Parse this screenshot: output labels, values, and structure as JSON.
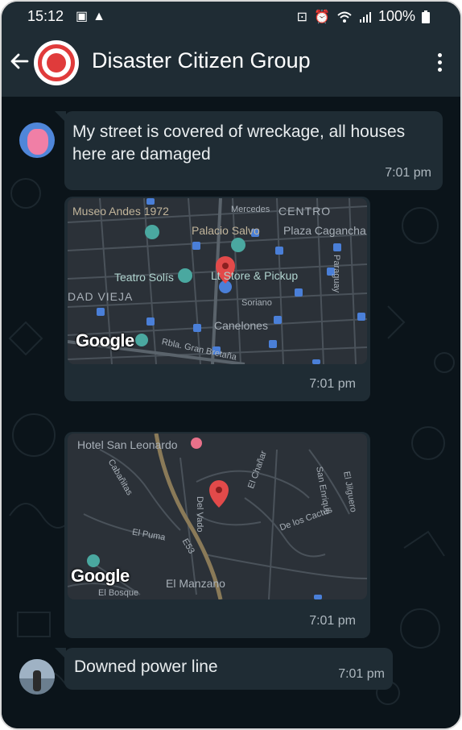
{
  "status_bar": {
    "time": "15:12",
    "left_icons": [
      "image-icon",
      "alert-icon"
    ],
    "right_icons": [
      "lock-icon",
      "alarm-icon",
      "wifi-icon",
      "signal-icon"
    ],
    "battery": "100%"
  },
  "header": {
    "title": "Disaster Citizen Group",
    "back_icon": "back-arrow-icon",
    "menu_icon": "more-vert-icon"
  },
  "messages": [
    {
      "type": "text",
      "text": "My street is covered of wreckage, all houses here are damaged",
      "time": "7:01 pm"
    },
    {
      "type": "location",
      "labels": {
        "museo": "Museo Andes 1972",
        "mercedes": "Mercedes",
        "centro": "CENTRO",
        "palacio": "Palacio Salvo",
        "plaza": "Plaza Cagancha",
        "teatro": "Teatro Solís",
        "store": "Lt Store & Pickup",
        "paraguay": "Paraguay",
        "vieja": "DAD VIEJA",
        "soriano": "Soriano",
        "canelones": "Canelones",
        "rbla": "Rbla. Gran Bretaña",
        "google": "Google"
      },
      "time": "7:01 pm"
    },
    {
      "type": "location",
      "labels": {
        "hotel": "Hotel San Leonardo",
        "cabanitas": "Cabañitas",
        "san_enrique": "San Enrique",
        "jilguero": "El Jilguero",
        "delvado": "Del Vado",
        "chanar": "El Chañar",
        "cactus": "De los Cactus",
        "puma": "El Puma",
        "e53": "E53",
        "manzano": "El Manzano",
        "bosque": "El Bosque",
        "google": "Google"
      },
      "time": "7:01 pm"
    },
    {
      "type": "text",
      "text": "Downed power line",
      "time": "7:01 pm"
    }
  ],
  "colors": {
    "header_bg": "#1f2c34",
    "chat_bg": "#0b141a",
    "bubble_bg": "#1f2c34",
    "pin": "#e24a4a"
  }
}
